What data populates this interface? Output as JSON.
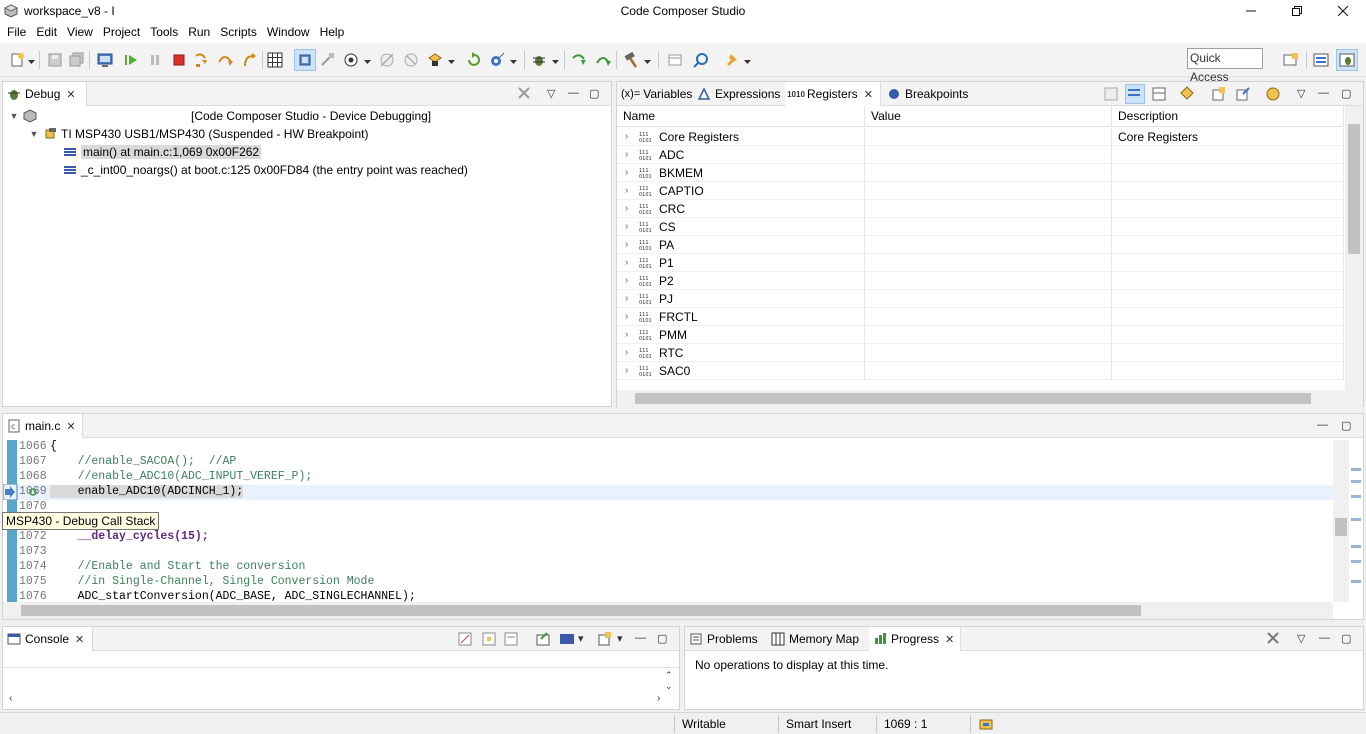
{
  "window": {
    "title": "workspace_v8 - I",
    "app_title": "Code Composer Studio"
  },
  "menu": [
    "File",
    "Edit",
    "View",
    "Project",
    "Tools",
    "Run",
    "Scripts",
    "Window",
    "Help"
  ],
  "toolbar": {
    "quick_access": "Quick Access"
  },
  "debug_view": {
    "tab_label": "Debug",
    "root_label": "[Code Composer Studio - Device Debugging]",
    "target_label": "TI MSP430 USB1/MSP430 (Suspended - HW Breakpoint)",
    "frames": [
      "main() at main.c:1,069 0x00F262",
      "_c_int00_noargs() at boot.c:125 0x00FD84  (the entry point was reached)"
    ]
  },
  "registers_view": {
    "tabs": [
      "Variables",
      "Expressions",
      "Registers",
      "Breakpoints"
    ],
    "variables_prefix": "(x)=",
    "columns": [
      "Name",
      "Value",
      "Description"
    ],
    "rows": [
      {
        "name": "Core Registers",
        "description": "Core Registers"
      },
      {
        "name": "ADC",
        "description": ""
      },
      {
        "name": "BKMEM",
        "description": ""
      },
      {
        "name": "CAPTIO",
        "description": ""
      },
      {
        "name": "CRC",
        "description": ""
      },
      {
        "name": "CS",
        "description": ""
      },
      {
        "name": "PA",
        "description": ""
      },
      {
        "name": "P1",
        "description": ""
      },
      {
        "name": "P2",
        "description": ""
      },
      {
        "name": "PJ",
        "description": ""
      },
      {
        "name": "FRCTL",
        "description": ""
      },
      {
        "name": "PMM",
        "description": ""
      },
      {
        "name": "RTC",
        "description": ""
      },
      {
        "name": "SAC0",
        "description": ""
      }
    ]
  },
  "editor": {
    "tab_label": "main.c",
    "lines": [
      {
        "num": "1066",
        "text": "{",
        "kind": "plain"
      },
      {
        "num": "1067",
        "text": "    //enable_SACOA();  //AP",
        "kind": "comment"
      },
      {
        "num": "1068",
        "text": "    //enable_ADC10(ADC_INPUT_VEREF_P);",
        "kind": "comment"
      },
      {
        "num": "1069",
        "text": "    enable_ADC10(ADCINCH_1);",
        "kind": "current"
      },
      {
        "num": "1070",
        "text": "",
        "kind": "plain"
      },
      {
        "num": "1071",
        "text": "",
        "kind": "plain"
      },
      {
        "num": "1072",
        "text": "    __delay_cycles(15);",
        "kind": "func"
      },
      {
        "num": "1073",
        "text": "",
        "kind": "plain"
      },
      {
        "num": "1074",
        "text": "    //Enable and Start the conversion",
        "kind": "comment"
      },
      {
        "num": "1075",
        "text": "    //in Single-Channel, Single Conversion Mode",
        "kind": "comment"
      },
      {
        "num": "1076",
        "text": "    ADC_startConversion(ADC_BASE, ADC_SINGLECHANNEL);",
        "kind": "plain"
      }
    ],
    "tooltip": "MSP430 - Debug Call Stack"
  },
  "console_view": {
    "tab_label": "Console"
  },
  "progress_view": {
    "tabs": [
      "Problems",
      "Memory Map",
      "Progress"
    ],
    "message": "No operations to display at this time."
  },
  "status": {
    "writable": "Writable",
    "insert_mode": "Smart Insert",
    "position": "1069 : 1"
  }
}
